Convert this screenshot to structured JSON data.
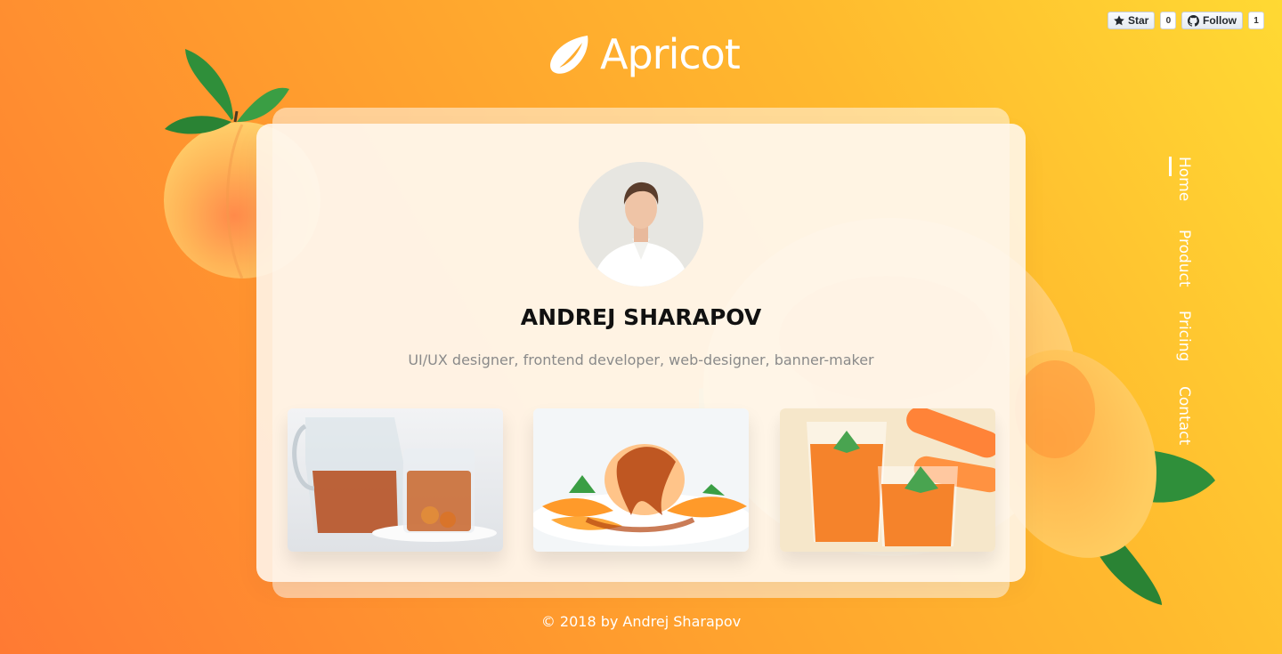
{
  "brand": {
    "name": "Apricot",
    "logo_icon": "crescent-leaf-icon"
  },
  "github": {
    "star_label": "Star",
    "star_count": "0",
    "follow_label": "Follow",
    "follow_count": "1"
  },
  "profile": {
    "name": "ANDREJ SHARAPOV",
    "role": "UI/UX designer, frontend developer, web-designer, banner-maker"
  },
  "gallery": [
    {
      "name": "apricot tea"
    },
    {
      "name": "ice cream with apricots"
    },
    {
      "name": "apricot smoothie"
    }
  ],
  "nav": {
    "items": [
      "Home",
      "Product",
      "Pricing",
      "Contact"
    ],
    "active": "Home"
  },
  "footer": {
    "text": "© 2018 by Andrej Sharapov"
  },
  "colors": {
    "gradient_start": "#ff7a33",
    "gradient_end": "#ffd933",
    "text_dark": "#111111",
    "text_muted": "#8a8a8a"
  }
}
